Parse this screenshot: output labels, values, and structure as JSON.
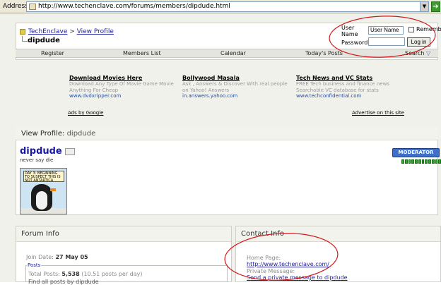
{
  "browser": {
    "address_label": "Address",
    "url": "http://www.techenclave.com/forums/members/dipdude.html",
    "go_icon": "go-arrow-icon"
  },
  "header": {
    "breadcrumb_home": "TechEnclave",
    "breadcrumb_sep": ">",
    "breadcrumb_current": "View Profile",
    "page_user": "dipdude"
  },
  "login": {
    "user_label": "User Name",
    "user_value": "User Name",
    "password_label": "Password",
    "remember_label": "Remember",
    "button_label": "Log in"
  },
  "nav": {
    "items": [
      "Register",
      "Members List",
      "Calendar",
      "Today's Posts",
      "Search"
    ]
  },
  "ads": {
    "items": [
      {
        "title": "Download Movies Here",
        "line1": "Download Any Type Of Movie Game Movie",
        "line2": "Anything For Cheap",
        "url": "www.dvdxripper.com"
      },
      {
        "title": "Bollywood Masala",
        "line1": "Ask , Answers & Discover With real people",
        "line2": "on Yahoo! Answers",
        "url": "in.answers.yahoo.com"
      },
      {
        "title": "Tech News and VC Stats",
        "line1": "FREE Tech business and finance news",
        "line2": "Searchable VC database for stats",
        "url": "www.techconfidential.com"
      }
    ],
    "ads_by": "Ads by Google",
    "advertise": "Advertise on this site"
  },
  "profile": {
    "section_title": "View Profile",
    "section_user": "dipdude",
    "name": "dipdude",
    "tagline": "never say die",
    "avatar_caption": "DAY 3: BEGINNING TO SUSPECT THIS IS NOT ANTARTICA",
    "badge": "MODERATOR",
    "reputation_pips": 12
  },
  "forum_info": {
    "title": "Forum Info",
    "join_label": "Join Date:",
    "join_value": "27 May 05",
    "posts_legend": "Posts",
    "total_label": "Total Posts:",
    "total_value": "5,538",
    "per_day": "(10.51 posts per day)",
    "find_all": "Find all posts by dipdude"
  },
  "contact_info": {
    "title": "Contact Info",
    "home_label": "Home Page:",
    "home_url": "http://www.techenclave.com/",
    "pm_label": "Private Message:",
    "pm_link": "Send a private message to dipdude"
  },
  "colors": {
    "annotation": "#d01818",
    "link": "#22229c",
    "badge": "#3e6fc9"
  }
}
